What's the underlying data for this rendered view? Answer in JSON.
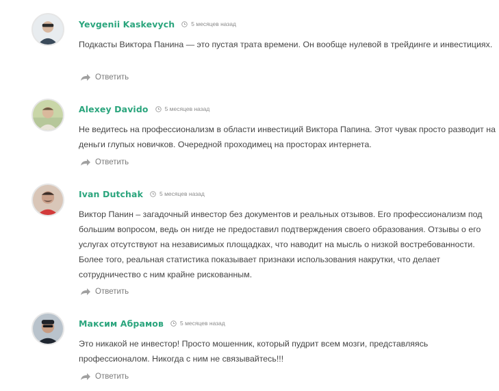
{
  "comments": [
    {
      "author": "Yevgenii Kaskevych",
      "time": "5 месяцев назад",
      "text": "Подкасты Виктора Панина — это пустая трата времени. Он вообще нулевой в трейдинге и инвестициях.",
      "reply": "Ответить"
    },
    {
      "author": "Alexey Davido",
      "time": "5 месяцев назад",
      "text": "Не ведитесь на профессионализм в области инвестиций Виктора Папина. Этот чувак просто разводит на деньги глупых новичков. Очередной проходимец на просторах интернета.",
      "reply": "Ответить"
    },
    {
      "author": "Ivan Dutchak",
      "time": "5 месяцев назад",
      "text": "Виктор Панин – загадочный инвестор без документов и реальных отзывов. Его профессионализм под большим вопросом, ведь он нигде не предоставил подтверждения своего образования. Отзывы о его услугах отсутствуют на независимых площадках, что наводит на мысль о низкой востребованности. Более того, реальная статистика показывает признаки использования накрутки, что делает сотрудничество с ним крайне рискованным.",
      "reply": "Ответить"
    },
    {
      "author": "Максим Абрамов",
      "time": "5 месяцев назад",
      "text": "Это никакой не инвестор! Просто мошенник, который пудрит всем мозги, представляясь профессионалом. Никогда с ним не связывайтесь!!!",
      "reply": "Ответить"
    }
  ],
  "colors": {
    "author": "#2ba57d",
    "text": "#444444",
    "time": "#8a8a8a",
    "reply": "#7a7a7a"
  },
  "icons": {
    "time": "clock-icon",
    "reply": "reply-arrow-icon"
  }
}
